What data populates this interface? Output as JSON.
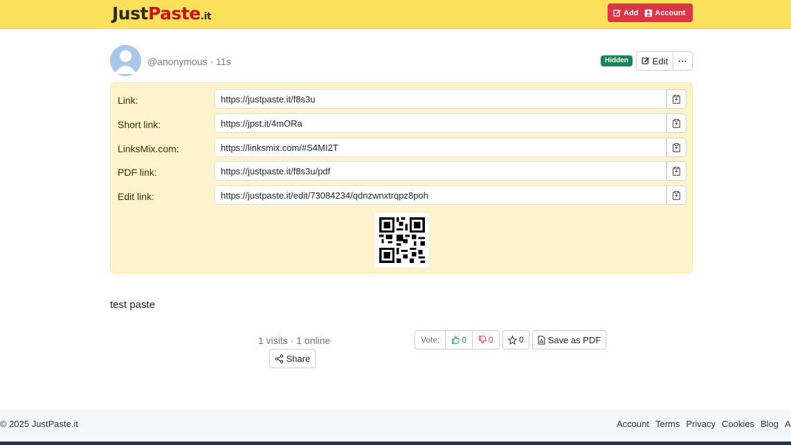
{
  "header": {
    "logo": {
      "just": "Just",
      "paste": "Paste",
      "it": ".it"
    },
    "add_label": "Add",
    "account_label": "Account"
  },
  "paste": {
    "author": "@anonymous",
    "age": "11s",
    "badge": "Hidden",
    "edit_label": "Edit",
    "more_label": "···",
    "links": [
      {
        "label": "Link:",
        "value": "https://justpaste.it/f8s3u"
      },
      {
        "label": "Short link:",
        "value": "https://jpst.it/4mORa"
      },
      {
        "label": "LinksMix.com:",
        "value": "https://linksmix.com/#S4MI2T"
      },
      {
        "label": "PDF link:",
        "value": "https://justpaste.it/f8s3u/pdf"
      },
      {
        "label": "Edit link:",
        "value": "https://justpaste.it/edit/73084234/qdnzwnxtrqpz8poh"
      }
    ],
    "content": "test paste"
  },
  "stats": {
    "text": "1 visits · 1 online",
    "share_label": "Share",
    "vote_label": "Vote:",
    "upvotes": "0",
    "downvotes": "0",
    "favorites": "0",
    "pdf_label": "Save as PDF"
  },
  "footer": {
    "copyright": "© 2025 JustPaste.it",
    "links": [
      "Account",
      "Terms",
      "Privacy",
      "Cookies",
      "Blog",
      "Ab"
    ]
  },
  "colors": {
    "topbar": "#fde05c",
    "brand_red": "#c8151b",
    "danger": "#dc3545",
    "success": "#198754",
    "linkbox_bg": "#fff3cd"
  }
}
